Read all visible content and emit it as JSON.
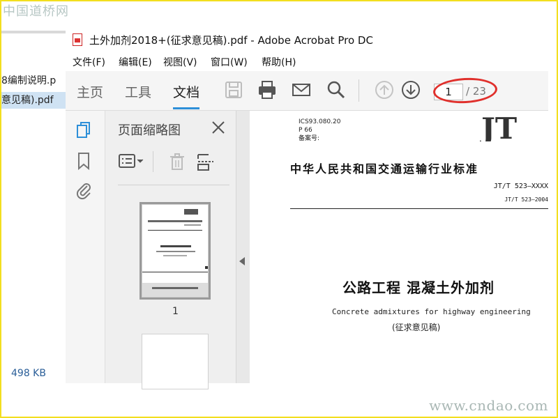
{
  "watermarks": {
    "top": "中国道桥网",
    "bottom": "www.cndao.com"
  },
  "explorer": {
    "rows": [
      "8编制说明.p",
      "意见稿).pdf"
    ],
    "size": "498 KB"
  },
  "window": {
    "title": "土外加剂2018+(征求意见稿).pdf - Adobe Acrobat Pro DC"
  },
  "menu": [
    "文件(F)",
    "编辑(E)",
    "视图(V)",
    "窗口(W)",
    "帮助(H)"
  ],
  "toolbar": {
    "tabs": [
      "主页",
      "工具",
      "文档"
    ],
    "active_tab": "文档",
    "page_current": "1",
    "page_total": "/ 23",
    "accent": "#2d8fd8",
    "highlight": "#e0302c"
  },
  "thumbnails": {
    "title": "页面缩略图",
    "page_label": "1"
  },
  "document": {
    "meta": [
      "ICS93.080.20",
      "P 66",
      "备案号:"
    ],
    "logo": "JT",
    "headline": "中华人民共和国交通运输行业标准",
    "code1": "JT/T 523—XXXX",
    "code2": "JT/T 523—2004",
    "title": "公路工程  混凝土外加剂",
    "title_en": "Concrete admixtures for highway engineering",
    "draft": "(征求意见稿)"
  }
}
